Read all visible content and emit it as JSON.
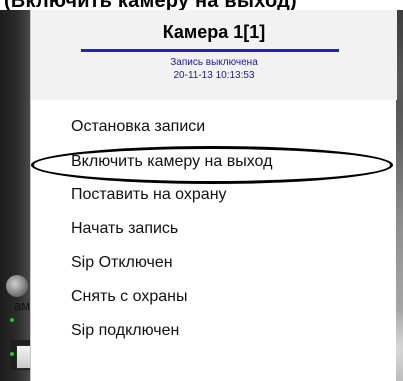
{
  "page_caption": "(Включить камеру на выход)",
  "background": {
    "label": "ам"
  },
  "menu": {
    "title": "Камера 1[1]",
    "status": {
      "recording_state": "Запись выключена",
      "timestamp": "20-11-13 10:13:53"
    },
    "items": [
      {
        "label": "Остановка записи"
      },
      {
        "label": "Включить камеру на выход",
        "highlighted": true
      },
      {
        "label": "Поставить на охрану"
      },
      {
        "label": "Начать запись"
      },
      {
        "label": "Sip Отключен"
      },
      {
        "label": "Снять с охраны"
      },
      {
        "label": "Sip подключен"
      }
    ]
  },
  "colors": {
    "title_rule": "#1a28b4",
    "status_text": "#1a1a9a",
    "highlight_ring": "#000000",
    "indicator_dot": "#1ad11a"
  }
}
